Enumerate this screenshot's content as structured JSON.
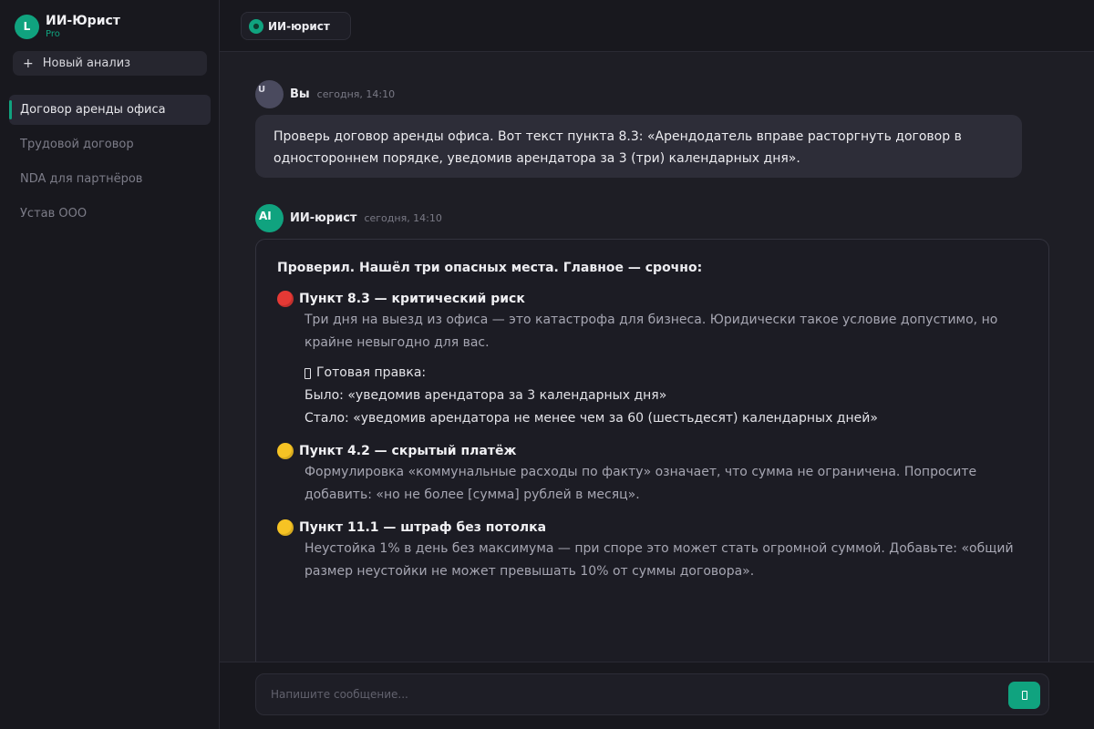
{
  "brand": {
    "logo": "L",
    "name": "ИИ-Юрист",
    "plan": "Pro"
  },
  "sidebar": {
    "new_label": "Новый анализ",
    "new_icon": "+",
    "items": [
      {
        "label": "Договор аренды офиса",
        "active": true
      },
      {
        "label": "Трудовой договор",
        "active": false
      },
      {
        "label": "NDA для партнёров",
        "active": false
      },
      {
        "label": "Устав ООО",
        "active": false
      }
    ]
  },
  "header": {
    "model_label": "ИИ-юрист",
    "model_icon": "ai-badge-icon"
  },
  "messages": {
    "user": {
      "avatar": "U",
      "author": "Вы",
      "time": "сегодня, 14:10",
      "text": "Проверь договор аренды офиса. Вот текст пункта 8.3: «Арендодатель вправе расторгнуть договор в одностороннем порядке, уведомив арендатора за 3 (три) календарных дня»."
    },
    "ai": {
      "avatar": "AI",
      "author": "ИИ-юрист",
      "time": "сегодня, 14:10",
      "intro": "Проверил. Нашёл три опасных места. Главное — срочно:",
      "issues": [
        {
          "severity": "red",
          "severity_color": "#e53935",
          "title": "Пункт 8.3 — критический риск",
          "body": "Три дня на выезд из офиса — это катастрофа для бизнеса. Юридически такое условие допустимо, но крайне невыгодно для вас.",
          "fix_label": "Готовая правка:",
          "fix_was": "Было: «уведомив арендатора за 3 календарных дня»",
          "fix_now": "Стало: «уведомив арендатора не менее чем за 60 (шестьдесят) календарных дней»"
        },
        {
          "severity": "yellow",
          "severity_color": "#f6c324",
          "title": "Пункт 4.2 — скрытый платёж",
          "body": "Формулировка «коммунальные расходы по факту» означает, что сумма не ограничена. Попросите добавить: «но не более [сумма] рублей в месяц»."
        },
        {
          "severity": "yellow",
          "severity_color": "#f6c324",
          "title": "Пункт 11.1 — штраф без потолка",
          "body": "Неустойка 1% в день без максимума — при споре это может стать огромной суммой. Добавьте: «общий размер неустойки не может превышать 10% от суммы договора»."
        }
      ]
    }
  },
  "composer": {
    "placeholder": "Напишите сообщение...",
    "send_icon": "send-icon"
  },
  "colors": {
    "accent": "#10a37f",
    "background": "#18181e",
    "panel": "#1e1e25"
  }
}
